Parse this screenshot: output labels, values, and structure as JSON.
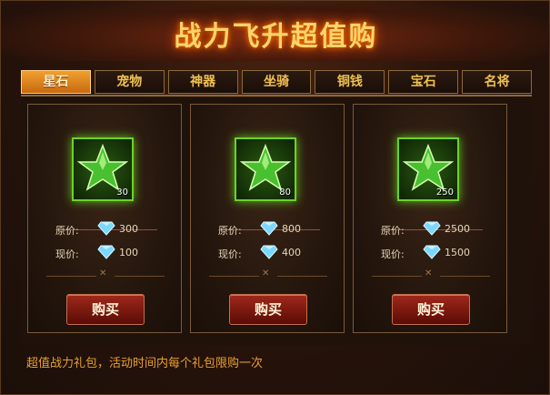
{
  "title": "战力飞升超值购",
  "tabs": [
    "星石",
    "宠物",
    "神器",
    "坐骑",
    "铜钱",
    "宝石",
    "名将"
  ],
  "active_tab": "星石",
  "labels": {
    "original_price": "原价:",
    "current_price": "现价:",
    "buy": "购买"
  },
  "items": [
    {
      "icon": "green-star-stone-icon",
      "quantity": "30",
      "original_price": "300",
      "current_price": "100"
    },
    {
      "icon": "green-star-stone-icon",
      "quantity": "80",
      "original_price": "800",
      "current_price": "400"
    },
    {
      "icon": "green-star-stone-icon",
      "quantity": "250",
      "original_price": "2500",
      "current_price": "1500"
    }
  ],
  "footer_note": "超值战力礼包，活动时间内每个礼包限购一次",
  "colors": {
    "accent": "#f0a030",
    "title": "#ffd36b",
    "button": "#a0281a",
    "footer": "#e8a030"
  }
}
